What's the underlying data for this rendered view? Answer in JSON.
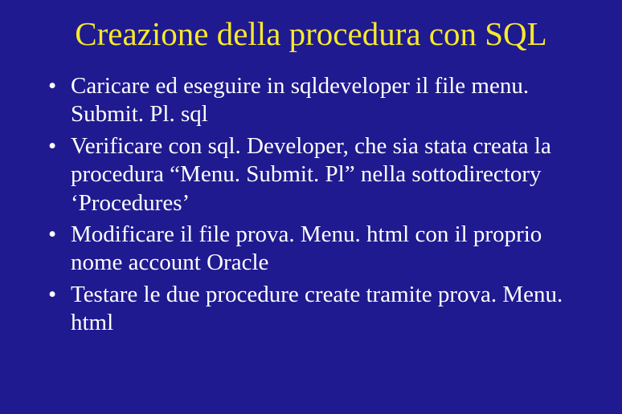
{
  "title": "Creazione della procedura con SQL",
  "bullets": [
    "Caricare ed eseguire in sqldeveloper il file menu. Submit. Pl. sql",
    "Verificare con sql. Developer, che sia stata creata la procedura “Menu. Submit. Pl” nella sottodirectory ‘Procedures’",
    "Modificare il file prova. Menu. html con il proprio nome account Oracle",
    "Testare le due procedure create tramite prova. Menu. html"
  ]
}
